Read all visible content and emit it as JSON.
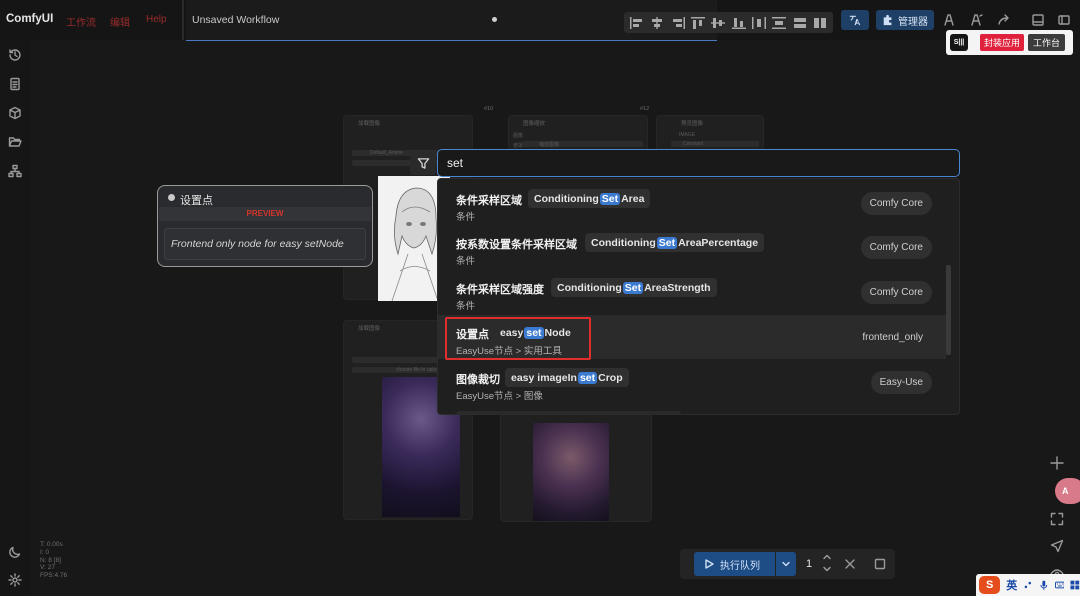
{
  "app": {
    "name": "ComfyUI"
  },
  "menu": [
    "工作流",
    "编辑",
    "Help"
  ],
  "workflow_tab": {
    "title": "Unsaved Workflow"
  },
  "toolbar": {
    "manager_label": "管理器"
  },
  "mini_app": {
    "logo_text": "S|||",
    "pack_label": "封装应用",
    "workbench_label": "工作台"
  },
  "stats": [
    "T: 0.00s",
    "I: 0",
    "N: 8 [8]",
    "V: 27",
    "FPS:4.76"
  ],
  "preview_node": {
    "title": "设置点",
    "header": "PREVIEW",
    "description": "Frontend only node for easy setNode"
  },
  "search": {
    "query": "set",
    "highlight": "set"
  },
  "results": [
    {
      "name": "条件采样区域",
      "prefix": "Conditioning",
      "hl": "Set",
      "suffix": "Area",
      "category": "条件",
      "source": "Comfy Core"
    },
    {
      "name": "按系数设置条件采样区域",
      "prefix": "Conditioning",
      "hl": "Set",
      "suffix": "AreaPercentage",
      "category": "条件",
      "source": "Comfy Core"
    },
    {
      "name": "条件采样区域强度",
      "prefix": "Conditioning",
      "hl": "Set",
      "suffix": "AreaStrength",
      "category": "条件",
      "source": "Comfy Core"
    },
    {
      "name": "设置点",
      "prefix": "easy ",
      "hl": "set",
      "suffix": "Node",
      "category": "EasyUse节点 > 实用工具",
      "source": "frontend_only"
    },
    {
      "name": "图像裁切",
      "prefix": "easy imageIn",
      "hl": "set",
      "suffix": "Crop",
      "category": "EasyUse节点 > 图像",
      "source": "Easy-Use"
    }
  ],
  "canvas": {
    "node_ids": [
      "#10",
      "#12"
    ],
    "node_titles": [
      "加载图像",
      "图像缩放",
      "预览图像",
      "加载图像"
    ],
    "inputs": [
      "图像",
      "遮罩",
      "IMAGE"
    ],
    "image_label": "Default_Anime",
    "upload_label": "choose file to upload",
    "constant_label": "Constant",
    "scale_label": "缩放图像"
  },
  "run": {
    "label": "执行队列",
    "count": "1"
  },
  "ime": {
    "lang": "英",
    "logo": "S"
  },
  "translate_fab": {
    "label": "A"
  },
  "colors": {
    "accent": "#3b7ad1",
    "brand_red": "#e0213c",
    "highlight_box": "#e02e2e"
  }
}
